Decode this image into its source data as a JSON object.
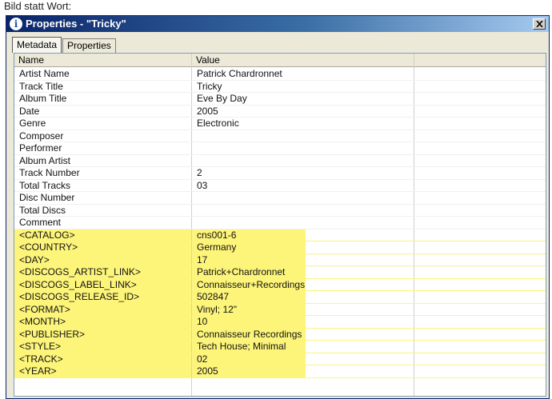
{
  "caption": "Bild statt Wort:",
  "window": {
    "title": "Properties - \"Tricky\"",
    "info_icon": "info-icon",
    "close_glyph": "×"
  },
  "tabs": [
    {
      "label": "Metadata",
      "active": true
    },
    {
      "label": "Properties",
      "active": false
    }
  ],
  "columns": {
    "name": "Name",
    "value": "Value"
  },
  "highlight_color": "#fdf57a",
  "rows": [
    {
      "name": "Artist Name",
      "value": "Patrick Chardronnet",
      "highlight": false
    },
    {
      "name": "Track Title",
      "value": "Tricky",
      "highlight": false
    },
    {
      "name": "Album Title",
      "value": "Eve By Day",
      "highlight": false
    },
    {
      "name": "Date",
      "value": "2005",
      "highlight": false
    },
    {
      "name": "Genre",
      "value": "Electronic",
      "highlight": false
    },
    {
      "name": "Composer",
      "value": "",
      "highlight": false
    },
    {
      "name": "Performer",
      "value": "",
      "highlight": false
    },
    {
      "name": "Album Artist",
      "value": "",
      "highlight": false
    },
    {
      "name": "Track Number",
      "value": "2",
      "highlight": false
    },
    {
      "name": "Total Tracks",
      "value": "03",
      "highlight": false
    },
    {
      "name": "Disc Number",
      "value": "",
      "highlight": false
    },
    {
      "name": "Total Discs",
      "value": "",
      "highlight": false
    },
    {
      "name": "Comment",
      "value": "",
      "highlight": false
    },
    {
      "name": "<CATALOG>",
      "value": "cns001-6",
      "highlight": true
    },
    {
      "name": "<COUNTRY>",
      "value": "Germany",
      "highlight": true
    },
    {
      "name": "<DAY>",
      "value": "17",
      "highlight": true
    },
    {
      "name": "<DISCOGS_ARTIST_LINK>",
      "value": "Patrick+Chardronnet",
      "highlight": true
    },
    {
      "name": "<DISCOGS_LABEL_LINK>",
      "value": "Connaisseur+Recordings",
      "highlight": true
    },
    {
      "name": "<DISCOGS_RELEASE_ID>",
      "value": "502847",
      "highlight": true
    },
    {
      "name": "<FORMAT>",
      "value": "Vinyl; 12\"",
      "highlight": true
    },
    {
      "name": "<MONTH>",
      "value": "10",
      "highlight": true
    },
    {
      "name": "<PUBLISHER>",
      "value": "Connaisseur Recordings",
      "highlight": true
    },
    {
      "name": "<STYLE>",
      "value": "Tech House; Minimal",
      "highlight": true
    },
    {
      "name": "<TRACK>",
      "value": "02",
      "highlight": true
    },
    {
      "name": "<YEAR>",
      "value": "2005",
      "highlight": true
    }
  ]
}
